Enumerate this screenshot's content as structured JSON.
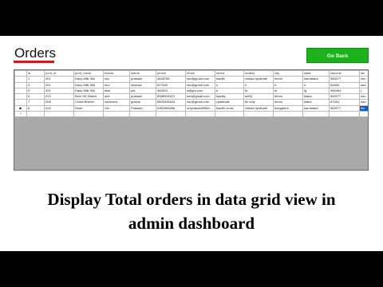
{
  "header": {
    "title": "Orders",
    "go_back_label": "Go Back",
    "accent_color": "#d11a1a",
    "button_color": "#1bb21b"
  },
  "grid": {
    "columns": [
      "",
      "id",
      "prod_id",
      "prod_name",
      "fname",
      "lname",
      "phone",
      "email",
      "street",
      "locality",
      "city",
      "state",
      "zipcode",
      "lan"
    ],
    "rows": [
      {
        "marker": "",
        "cells": [
          "1",
          "001",
          "Dairy Milk Silk",
          "ssv",
          "prakash",
          "5845765",
          "ssv@gmail.com",
          "tsadfh",
          "chikka byrahatti",
          "bbnm",
          "karnataka",
          "560077",
          "shu"
        ]
      },
      {
        "marker": "",
        "cells": [
          "3",
          "001",
          "Dairy Milk Silk",
          "tom",
          "sharma",
          "627645",
          "ssv@gmail.com",
          "h",
          "h",
          "h",
          "n",
          "64654",
          "asd"
        ]
      },
      {
        "marker": "",
        "cells": [
          "5",
          "001",
          "Dairy Milk Silk",
          "alok",
          "pai",
          "464512",
          "a@gm.com",
          "b",
          "fs",
          "fs",
          "fg",
          "465464",
          "j"
        ]
      },
      {
        "marker": "",
        "cells": [
          "6",
          "013",
          "Bern 5G Watch",
          "sed",
          "prakash",
          "8088926421",
          "sed@gmail.com",
          "tsadfsj",
          "adhfj",
          "bbnm",
          "ktaka",
          "560077",
          "shu"
        ]
      },
      {
        "marker": "",
        "cells": [
          "7",
          "008",
          "Chota Bheem",
          "narendra",
          "gowda",
          "6605345644",
          "nar@gmail.com",
          "cyalahalli",
          "tle only",
          "bbnm",
          "ktaka",
          "87654",
          "asd"
        ]
      },
      {
        "marker": "▶",
        "cells": [
          "8",
          "015",
          "Rose",
          "Om",
          "Prakash",
          "6362565456",
          "omprakash5584...",
          "tsadfh cross",
          "chikka byrahatti",
          "bangalore",
          "karnataka",
          "560077",
          "blo"
        ]
      },
      {
        "marker": "*",
        "cells": [
          "",
          "",
          "",
          "",
          "",
          "",
          "",
          "",
          "",
          "",
          "",
          "",
          ""
        ]
      }
    ],
    "selected_row": 5,
    "selected_col": 12
  },
  "caption": {
    "line1": "Display Total orders in data grid view in",
    "line2": "admin dashboard"
  }
}
